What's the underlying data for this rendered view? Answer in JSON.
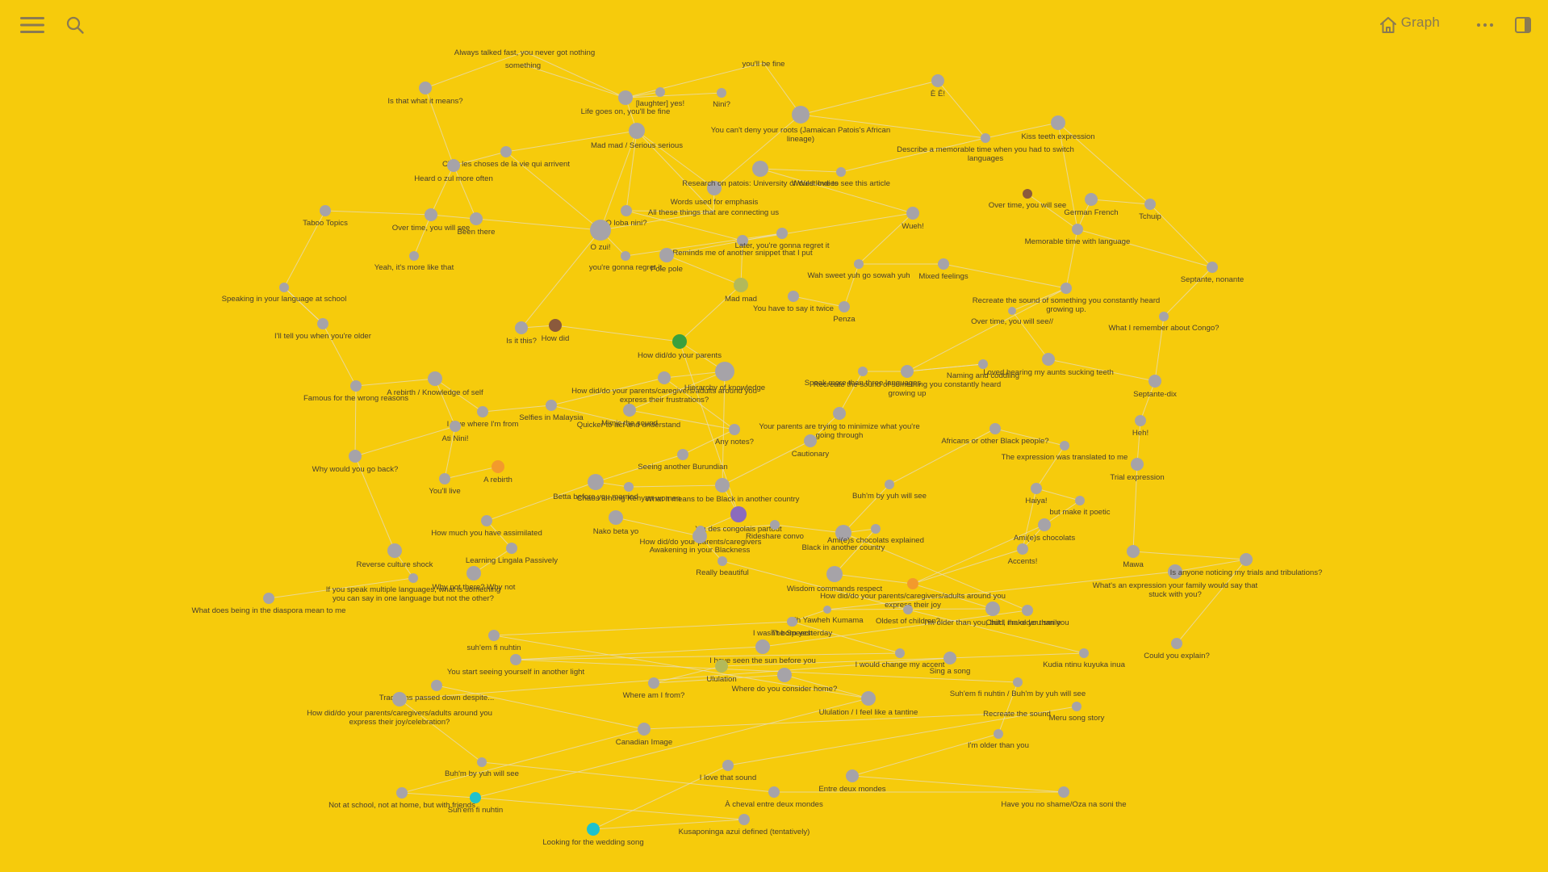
{
  "header": {
    "title": "Graph",
    "icons": {
      "menu": "hamburger-menu-icon",
      "search": "search-icon",
      "home": "home-icon",
      "more": "more-horizontal-icon",
      "sidebar": "sidebar-toggle-icon"
    }
  },
  "colors": {
    "background": "#f6cb0c",
    "node_default": "#a6a3a8",
    "edge": "#e5dcc0",
    "label": "#4a4030",
    "icon": "#8a7a52"
  },
  "graph": {
    "nodes": [
      {
        "label": "Always talked fast, you never got nothing"
      },
      {
        "label": "something"
      },
      {
        "label": "you'll be fine"
      },
      {
        "label": "Is that what it means?"
      },
      {
        "label": "[laughter] yes!"
      },
      {
        "label": "Nini?"
      },
      {
        "label": "Life goes on, you'll be fine"
      },
      {
        "label": "È Ê!"
      },
      {
        "label": "You can't deny your roots (Jamaican Patois's African lineage)"
      },
      {
        "label": "Mad mad / Serious serious"
      },
      {
        "label": "Kiss teeth expression"
      },
      {
        "label": "Describe a memorable time when you had to switch languages"
      },
      {
        "label": "C'est les choses de la vie qui arrivent"
      },
      {
        "label": "Would love to see this article"
      },
      {
        "label": "Heard o zul more often"
      },
      {
        "label": "Words used for emphasis"
      },
      {
        "label": "Research on patois: University of West Indies"
      },
      {
        "label": "Over time, you will see"
      },
      {
        "label": "German French"
      },
      {
        "label": "Tchuip"
      },
      {
        "label": "All these things that are connecting us"
      },
      {
        "label": "Taboo Topics"
      },
      {
        "label": "Over time, you will see"
      },
      {
        "label": "Been there"
      },
      {
        "label": "O loba nini?"
      },
      {
        "label": "Wueh!"
      },
      {
        "label": "Memorable time with language"
      },
      {
        "label": "O zui!"
      },
      {
        "label": "Reminds me of another snippet that I put"
      },
      {
        "label": "Later, you're gonna regret it"
      },
      {
        "label": "Yeah, it's more like that"
      },
      {
        "label": "you're gonna regret it"
      },
      {
        "label": "Pole pole"
      },
      {
        "label": "Wah sweet yuh go sowah yuh"
      },
      {
        "label": "Mixed feelings"
      },
      {
        "label": "Septante, nonante"
      },
      {
        "label": "Speaking in your language at school"
      },
      {
        "label": "Mad mad"
      },
      {
        "label": "You have to say it twice"
      },
      {
        "label": "Recreate the sound of something you constantly heard growing up."
      },
      {
        "label": "Penza"
      },
      {
        "label": "Over time, you will see//"
      },
      {
        "label": "What I remember about Congo?"
      },
      {
        "label": "I'll tell you when you're older"
      },
      {
        "label": "Is it this?"
      },
      {
        "label": "How did"
      },
      {
        "label": "How did/do your parents"
      },
      {
        "label": "Hierarchy of knowledge"
      },
      {
        "label": "Speak more than three languages"
      },
      {
        "label": "Recreate the sound of something you constantly heard growing up"
      },
      {
        "label": "Loved hearing my aunts sucking teeth"
      },
      {
        "label": "Famous for the wrong reasons"
      },
      {
        "label": "A rebirth / Knowledge of self"
      },
      {
        "label": "How did/do your parents/caregivers/adults around you express their frustrations?"
      },
      {
        "label": "Naming and coddling"
      },
      {
        "label": "Septante-dix"
      },
      {
        "label": "I love where I'm from"
      },
      {
        "label": "Selfies in Malaysia"
      },
      {
        "label": "Mimic the sound"
      },
      {
        "label": "Quicker to act and understand"
      },
      {
        "label": "Your parents are trying to minimize what you're going through"
      },
      {
        "label": "Any notes?"
      },
      {
        "label": "Africans or other Black people?"
      },
      {
        "label": "Heh!"
      },
      {
        "label": "Ati Nini!"
      },
      {
        "label": "Cautionary"
      },
      {
        "label": "The expression was translated to me"
      },
      {
        "label": "Why would you go back?"
      },
      {
        "label": "A rebirth"
      },
      {
        "label": "Seeing another Burundian"
      },
      {
        "label": "Trial expression"
      },
      {
        "label": "You'll live"
      },
      {
        "label": "Betta before you married"
      },
      {
        "label": "Chaos among Kenyan women"
      },
      {
        "label": "What it means to be Black in another country"
      },
      {
        "label": "Buh'm by yuh will see"
      },
      {
        "label": "Haiya!"
      },
      {
        "label": "but make it poetic"
      },
      {
        "label": "Y'a des congolais partout"
      },
      {
        "label": "Nako beta yo"
      },
      {
        "label": "How much you have assimilated"
      },
      {
        "label": "How did/do your parents/caregivers"
      },
      {
        "label": "Rideshare convo"
      },
      {
        "label": "Black in another country"
      },
      {
        "label": "Ami(e)s chocolats"
      },
      {
        "label": "Awakening in your Blackness"
      },
      {
        "label": "Ami(e)s chocolats explained"
      },
      {
        "label": "Reverse culture shock"
      },
      {
        "label": "Learning Lingala Passively"
      },
      {
        "label": "Accents!"
      },
      {
        "label": "Mawa"
      },
      {
        "label": "Really beautiful"
      },
      {
        "label": "Why not there? Why not"
      },
      {
        "label": "Wisdom commands respect"
      },
      {
        "label": "If you speak multiple languages, what is something you can say in one language but not the other?"
      },
      {
        "label": "What's an expression your family would say that stuck with you?"
      },
      {
        "label": "Is anyone noticing my trials and tribulations?"
      },
      {
        "label": "How did/do your parents/caregivers/adults around you express their joy"
      },
      {
        "label": "What does being in the diaspora mean to me"
      },
      {
        "label": "I'm older than you, but I make you smile"
      },
      {
        "label": "Eh Yawheh Kumama"
      },
      {
        "label": "I wasn't born yesterday"
      },
      {
        "label": "Child, I'm older than you"
      },
      {
        "label": "Oldest of children?"
      },
      {
        "label": "The Speech"
      },
      {
        "label": "suh'em fi nuhtin"
      },
      {
        "label": "Could you explain?"
      },
      {
        "label": "I have seen the sun before you"
      },
      {
        "label": "I would change my accent"
      },
      {
        "label": "Kudia ntinu kuyuka inua"
      },
      {
        "label": "You start seeing yourself in another light"
      },
      {
        "label": "Sing a song"
      },
      {
        "label": "Ululation"
      },
      {
        "label": "Where am I from?"
      },
      {
        "label": "Where do you consider home?"
      },
      {
        "label": "Traditions passed down despite..."
      },
      {
        "label": "Ululation / I feel like a tantine"
      },
      {
        "label": "How did/do your parents/caregivers/adults around you express their joy/celebration?"
      },
      {
        "label": "Suh'em fi nuhtin / Buh'm by yuh will see"
      },
      {
        "label": "Meru song story"
      },
      {
        "label": "Recreate the sound"
      },
      {
        "label": "Canadian Image"
      },
      {
        "label": "I'm older than you"
      },
      {
        "label": "Buh'm by yuh will see"
      },
      {
        "label": "I love that sound"
      },
      {
        "label": "Entre deux mondes"
      },
      {
        "label": "Not at school, not at home, but with friends"
      },
      {
        "label": "Suh'em fi nuhtin"
      },
      {
        "label": "Have you no shame/Oza na soni the"
      },
      {
        "label": "À cheval entre deux mondes"
      },
      {
        "label": "Looking for the wedding song"
      },
      {
        "label": "Kusaponinga azui defined (tentatively)"
      }
    ]
  }
}
